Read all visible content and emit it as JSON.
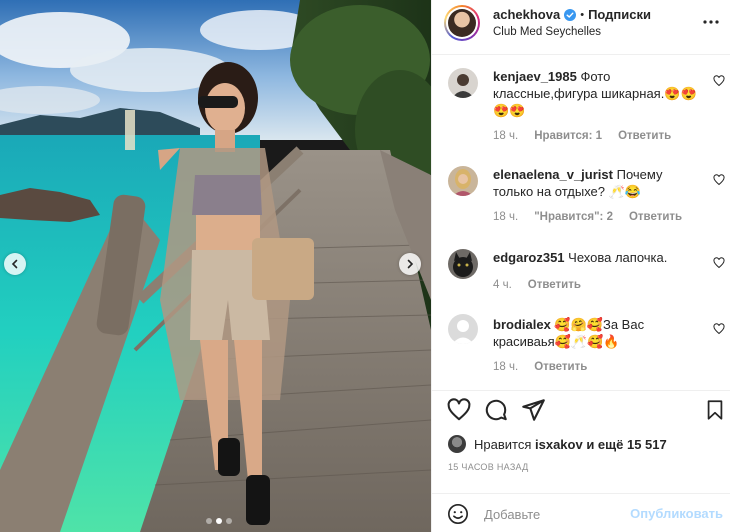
{
  "post": {
    "username": "achekhova",
    "verified": true,
    "separator": "•",
    "follow_label": "Подписки",
    "location": "Club Med Seychelles",
    "carousel": {
      "total_slides": 3,
      "active_slide": 2
    }
  },
  "comments": [
    {
      "username": "kenjaev_1985",
      "text": "Фото классные,фигура шикарная.😍😍😍😍",
      "time": "18 ч.",
      "likes_label": "Нравится: 1",
      "reply_label": "Ответить",
      "avatar_icon": "person-dark-icon"
    },
    {
      "username": "elenaelena_v_jurist",
      "text": "Почему только на отдыхе? 🥂😂",
      "time": "18 ч.",
      "likes_label": "\"Нравится\": 2",
      "reply_label": "Ответить",
      "avatar_icon": "person-blonde-icon"
    },
    {
      "username": "edgaroz351",
      "text": "Чехова лапочка.",
      "time": "4 ч.",
      "likes_label": "",
      "reply_label": "Ответить",
      "avatar_icon": "cat-icon"
    },
    {
      "username": "brodialex",
      "text": "🥰🤗🥰За Вас красиваья🥰🥂🥰🔥",
      "time": "18 ч.",
      "likes_label": "",
      "reply_label": "Ответить",
      "avatar_icon": "default-avatar-icon"
    }
  ],
  "likes": {
    "prefix": "Нравится",
    "user": "isxakov",
    "suffix": "и ещё 15 517"
  },
  "timestamp": "15 ЧАСОВ НАЗАД",
  "composer": {
    "placeholder": "Добавьте комментарий...",
    "visible_text": "Добавьте",
    "publish_label": "Опубликовать"
  },
  "colors": {
    "text": "#262626",
    "muted": "#8e8e8e",
    "verified": "#3897f0",
    "publish_disabled": "#b3dbff",
    "border": "#efefef"
  }
}
